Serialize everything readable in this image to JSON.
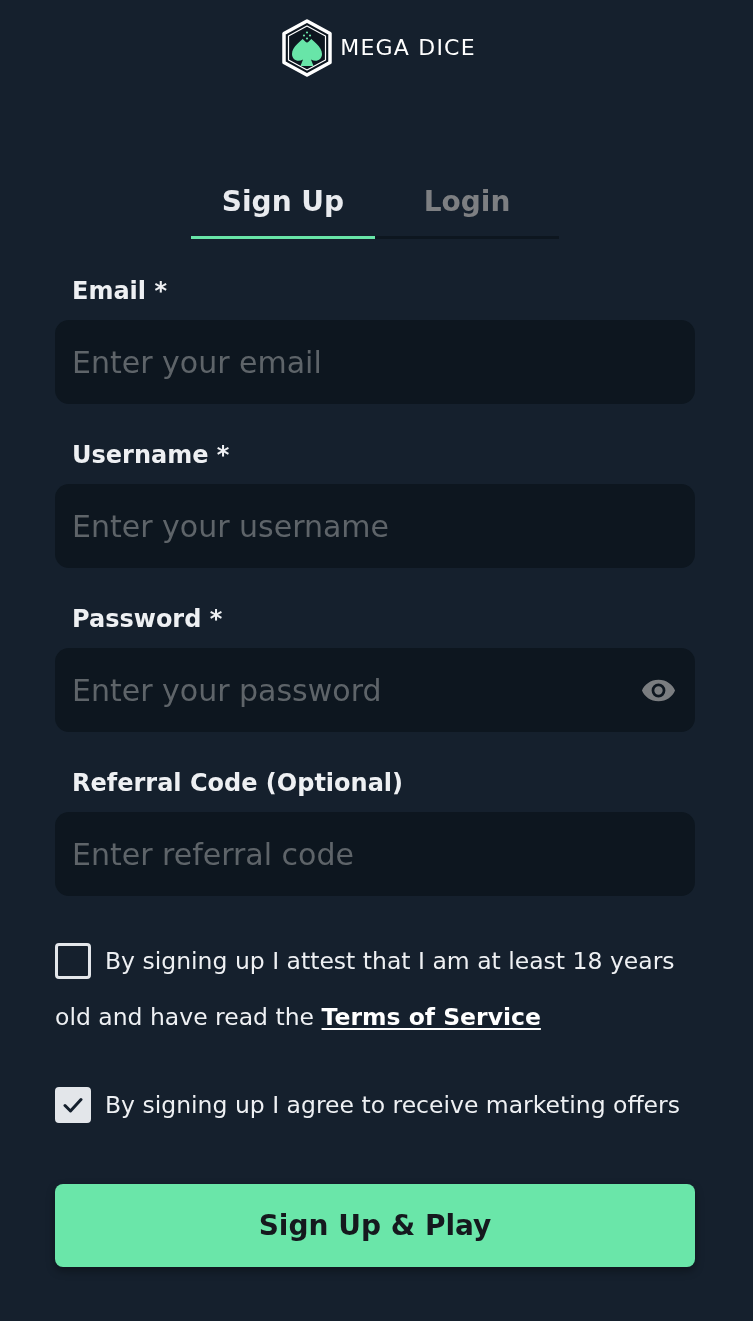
{
  "logo": {
    "text": "MEGA DICE"
  },
  "tabs": [
    {
      "label": "Sign Up",
      "selected": true
    },
    {
      "label": "Login",
      "selected": false
    }
  ],
  "fields": [
    {
      "label": "Email *",
      "placeholder": "Enter your email",
      "kind": "text"
    },
    {
      "label": "Username *",
      "placeholder": "Enter your username",
      "kind": "text"
    },
    {
      "label": "Password *",
      "placeholder": "Enter your password",
      "kind": "password"
    },
    {
      "label": "Referral Code (Optional)",
      "placeholder": "Enter referral code",
      "kind": "text"
    }
  ],
  "consents": [
    {
      "text": "By signing up I attest that I am at least 18 years old and have read the",
      "link": "Terms of Service",
      "checked": false
    },
    {
      "text": "By signing up I agree to receive marketing offers",
      "checked": true
    }
  ],
  "submit": {
    "label": "Sign Up & Play"
  }
}
